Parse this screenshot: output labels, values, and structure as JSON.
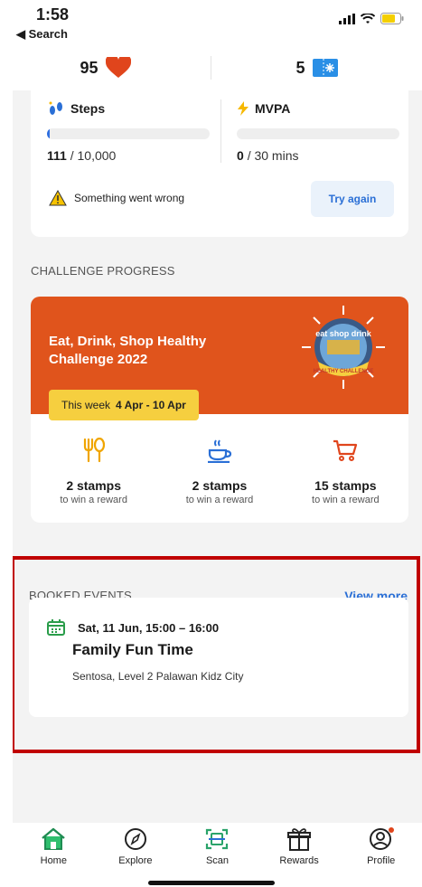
{
  "status": {
    "time": "1:58",
    "back_label": "◀ Search"
  },
  "header": {
    "hearts": "95",
    "tickets": "5"
  },
  "activity": {
    "steps": {
      "title": "Steps",
      "value": "111",
      "goal": "/ 10,000",
      "progress": 0.011
    },
    "mvpa": {
      "title": "MVPA",
      "value": "0",
      "goal": "/ 30 mins",
      "progress": 0
    },
    "error_text": "Something went wrong",
    "retry_label": "Try again"
  },
  "challenge": {
    "section_label": "CHALLENGE PROGRESS",
    "title_line1": "Eat, Drink, Shop Healthy",
    "title_line2": "Challenge 2022",
    "week_prefix": "This week",
    "week_range": "4 Apr - 10 Apr",
    "badge_text": "eat shop drink",
    "badge_ribbon": "HEALTHY CHALLENGE",
    "stamps": [
      {
        "icon": "fork-spoon-icon",
        "count": "2 stamps",
        "sub": "to win a reward"
      },
      {
        "icon": "cup-icon",
        "count": "2 stamps",
        "sub": "to win a reward"
      },
      {
        "icon": "cart-icon",
        "count": "15 stamps",
        "sub": "to win a reward"
      }
    ]
  },
  "booked": {
    "section_label": "BOOKED EVENTS",
    "view_more": "View more",
    "event": {
      "date": "Sat, 11 Jun, 15:00 – 16:00",
      "title": "Family Fun Time",
      "location": "Sentosa, Level 2 Palawan Kidz City"
    }
  },
  "nav": [
    {
      "label": "Home",
      "icon": "home-icon"
    },
    {
      "label": "Explore",
      "icon": "compass-icon"
    },
    {
      "label": "Scan",
      "icon": "scan-icon"
    },
    {
      "label": "Rewards",
      "icon": "gift-icon"
    },
    {
      "label": "Profile",
      "icon": "profile-icon"
    }
  ],
  "colors": {
    "accent_orange": "#e0541c",
    "accent_blue": "#2a6fd6",
    "highlight_red": "#c00000",
    "pill_yellow": "#f6cf3f"
  }
}
